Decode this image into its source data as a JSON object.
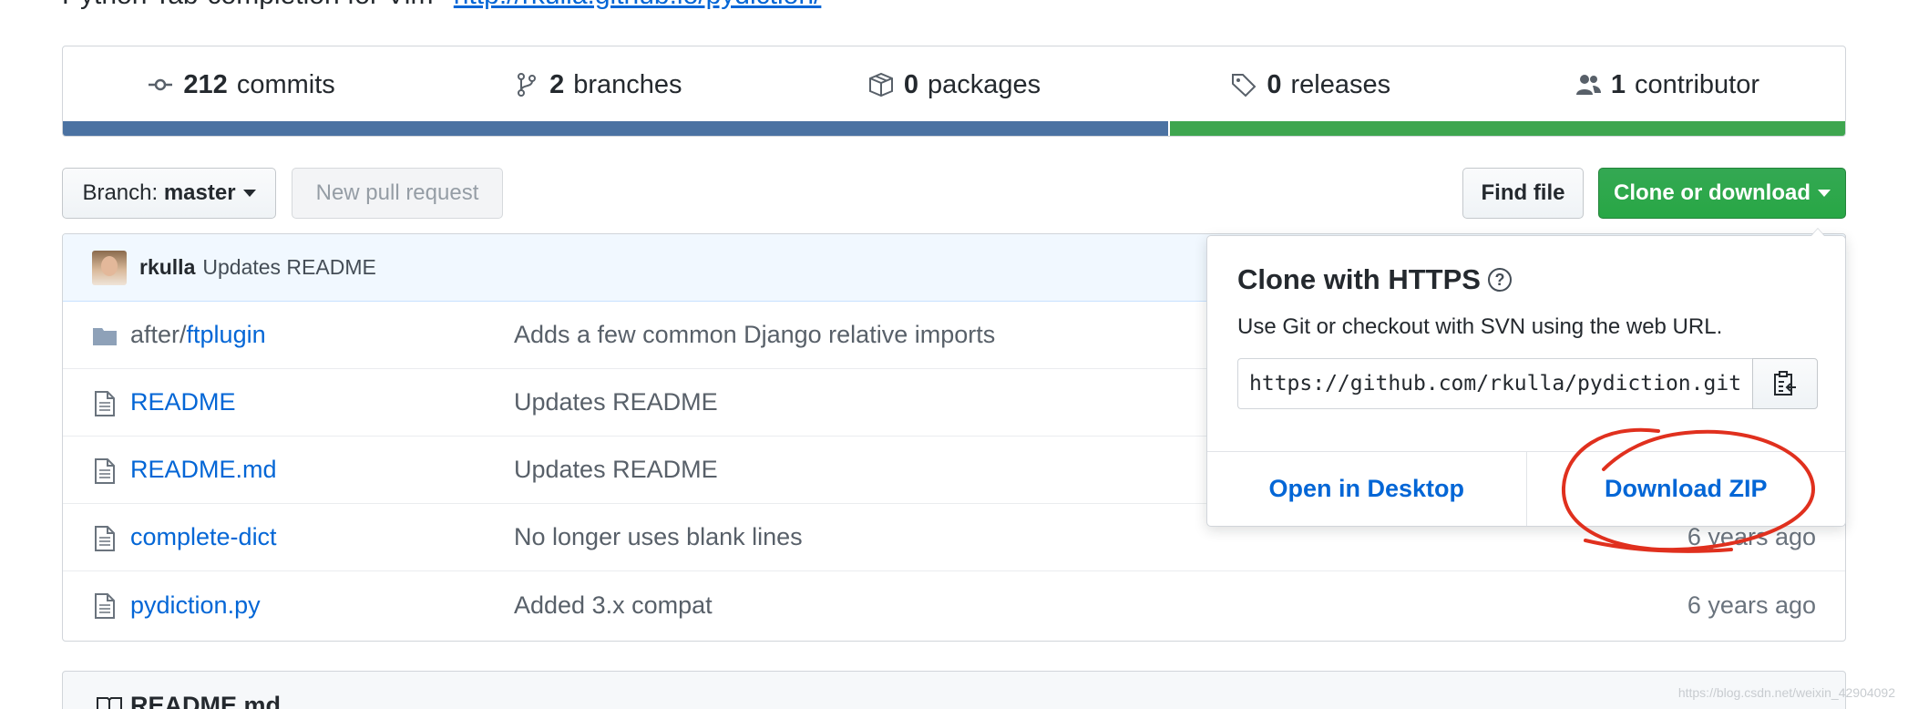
{
  "repo": {
    "description": "Python Tab-completion for Vim",
    "homepage": "http://rkulla.github.io/pydiction/"
  },
  "summary": [
    {
      "icon": "commits-icon",
      "count": "212",
      "label": "commits"
    },
    {
      "icon": "branch-icon",
      "count": "2",
      "label": "branches"
    },
    {
      "icon": "package-icon",
      "count": "0",
      "label": "packages"
    },
    {
      "icon": "tag-icon",
      "count": "0",
      "label": "releases"
    },
    {
      "icon": "people-icon",
      "count": "1",
      "label": "contributor"
    }
  ],
  "languages": [
    {
      "color": "#4b72a2",
      "fraction": 0.62
    },
    {
      "color": "#3ea64f",
      "fraction": 0.38
    }
  ],
  "toolbar": {
    "branch_label": "Branch:",
    "branch_value": "master",
    "new_pr": "New pull request",
    "find_file": "Find file",
    "clone_download": "Clone or download"
  },
  "latest_commit": {
    "author": "rkulla",
    "message": "Updates README"
  },
  "files": [
    {
      "type": "folder",
      "prefix": "after/",
      "name": "ftplugin",
      "message": "Adds a few common Django relative imports",
      "age": ""
    },
    {
      "type": "file",
      "prefix": "",
      "name": "README",
      "message": "Updates README",
      "age": ""
    },
    {
      "type": "file",
      "prefix": "",
      "name": "README.md",
      "message": "Updates README",
      "age": ""
    },
    {
      "type": "file",
      "prefix": "",
      "name": "complete-dict",
      "message": "No longer uses blank lines",
      "age": "6 years ago"
    },
    {
      "type": "file",
      "prefix": "",
      "name": "pydiction.py",
      "message": "Added 3.x compat",
      "age": "6 years ago"
    }
  ],
  "readme": {
    "title": "README.md"
  },
  "clone": {
    "title": "Clone with HTTPS",
    "help": "?",
    "description": "Use Git or checkout with SVN using the web URL.",
    "url": "https://github.com/rkulla/pydiction.git",
    "open_desktop": "Open in Desktop",
    "download_zip": "Download ZIP"
  },
  "colors": {
    "annotation": "#e0301e",
    "link": "#0366d6",
    "green": "#28a745"
  },
  "watermark": "https://blog.csdn.net/weixin_42904092"
}
